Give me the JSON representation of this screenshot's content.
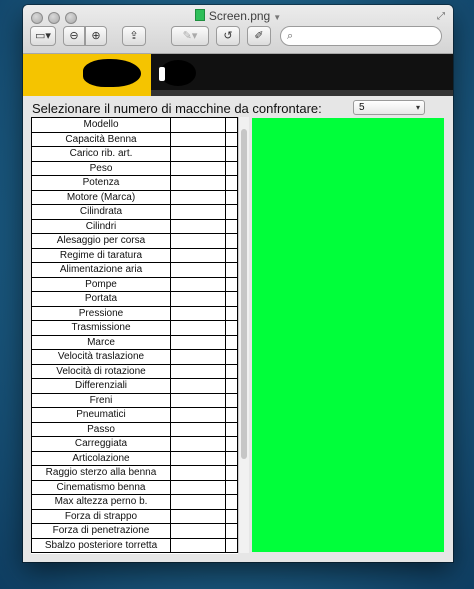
{
  "window": {
    "title": "Screen.png"
  },
  "toolbar": {
    "buttons": [
      {
        "name": "sidebar-toggle-button",
        "icon": "sidebar-icon",
        "glyph": "▭▾"
      },
      {
        "name": "zoom-out-button",
        "icon": "zoom-out-icon",
        "glyph": "⊖"
      },
      {
        "name": "zoom-in-button",
        "icon": "zoom-in-icon",
        "glyph": "⊕"
      },
      {
        "name": "share-button",
        "icon": "share-icon",
        "glyph": "⇪"
      },
      {
        "name": "annotate-button",
        "icon": "pen-icon",
        "glyph": "✎▾"
      },
      {
        "name": "rotate-button",
        "icon": "rotate-icon",
        "glyph": "↺"
      },
      {
        "name": "markup-button",
        "icon": "markup-icon",
        "glyph": "✐"
      }
    ],
    "search_icon": "⌕"
  },
  "page": {
    "prompt": "Selezionare il numero di macchine da confrontare:",
    "select_value": "5",
    "select_arrow": "▾"
  },
  "table": {
    "rows": [
      "Modello",
      "Capacità Benna",
      "Carico rib. art.",
      "Peso",
      "Potenza",
      "Motore (Marca)",
      "Cilindrata",
      "Cilindri",
      "Alesaggio per corsa",
      "Regime di taratura",
      "Alimentazione aria",
      "Pompe",
      "Portata",
      "Pressione",
      "Trasmissione",
      "Marce",
      "Velocità traslazione",
      "Velocità di rotazione",
      "Differenziali",
      "Freni",
      "Pneumatici",
      "Passo",
      "Carreggiata",
      "Articolazione",
      "Raggio sterzo alla benna",
      "Cinematismo benna",
      "Max altezza perno b.",
      "Forza di strappo",
      "Forza di penetrazione",
      "Sbalzo posteriore torretta"
    ]
  },
  "colors": {
    "banner_yellow": "#f5c400",
    "panel_green": "#00ff3a"
  }
}
